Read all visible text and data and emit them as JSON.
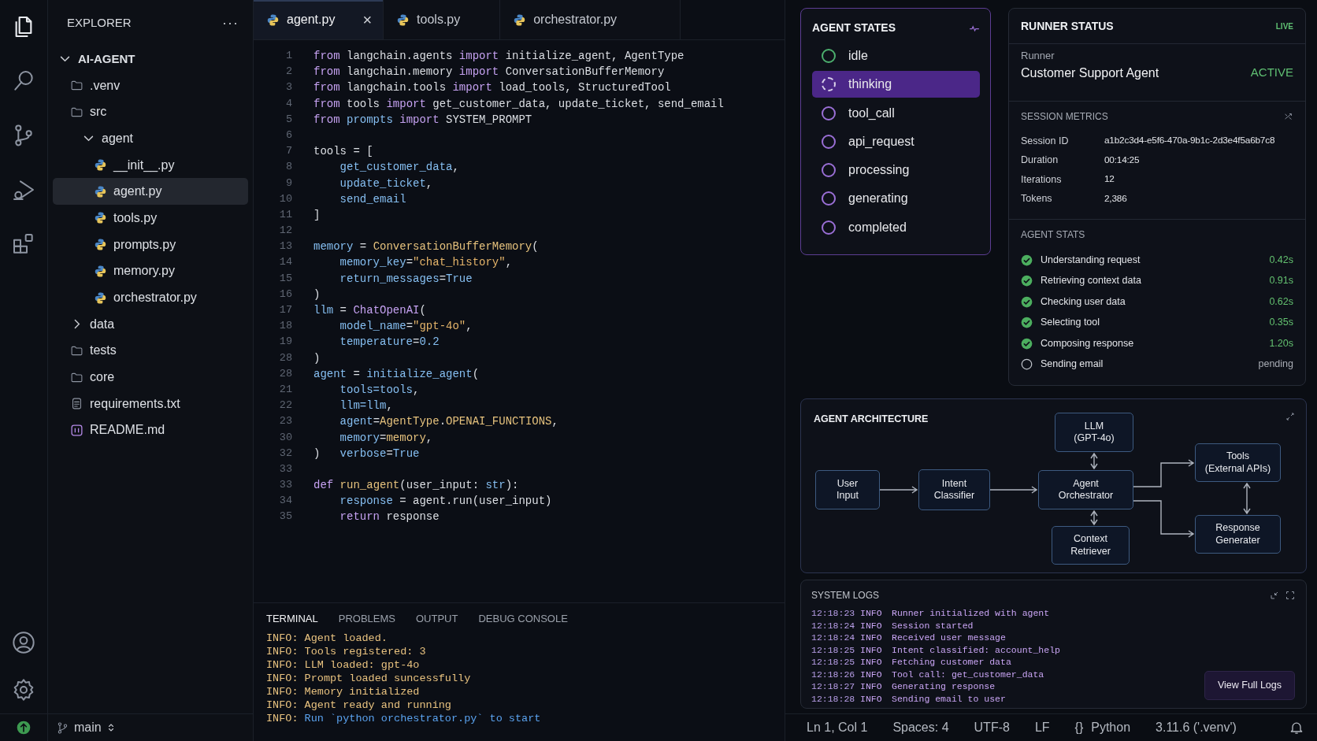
{
  "activity_bar": [
    {
      "selected": true
    },
    {
      "selected": false
    },
    {
      "selected": false
    },
    {
      "selected": false
    },
    {
      "selected": false
    }
  ],
  "sidebar": {
    "title": "EXPLORER",
    "more": "···",
    "tree": [
      {
        "label": "AI-AGENT",
        "kind": "root",
        "expanded": true,
        "selected": false,
        "children": [
          {
            "label": ".venv",
            "kind": "folder",
            "selected": false
          },
          {
            "label": "src",
            "kind": "folder",
            "selected": false,
            "children": [
              {
                "label": "agent",
                "expanded": true,
                "selected": false,
                "children": [
                  {
                    "label": "__init__.py",
                    "kind": "python",
                    "selected": false
                  },
                  {
                    "label": "agent.py",
                    "kind": "python",
                    "selected": true
                  },
                  {
                    "label": "tools.py",
                    "kind": "python",
                    "selected": false
                  },
                  {
                    "label": "prompts.py",
                    "kind": "python",
                    "selected": false
                  },
                  {
                    "label": "memory.py",
                    "kind": "python",
                    "selected": false
                  },
                  {
                    "label": "orchestrator.py",
                    "kind": "python",
                    "selected": false
                  }
                ]
              }
            ]
          },
          {
            "label": "data",
            "expanded": false,
            "selected": false
          },
          {
            "label": "tests",
            "kind": "folder",
            "selected": false
          },
          {
            "label": "core",
            "kind": "folder",
            "selected": false
          },
          {
            "label": "requirements.txt",
            "kind": "text",
            "selected": false
          },
          {
            "label": "README.md",
            "kind": "markdown",
            "selected": false
          }
        ]
      }
    ]
  },
  "branch": "main",
  "editor_tabs": [
    {
      "label": "agent.py",
      "selected": true,
      "close": "×"
    },
    {
      "label": "tools.py",
      "selected": false
    },
    {
      "label": "orchestrator.py",
      "selected": false
    }
  ],
  "code": [
    {
      "number": "1",
      "tokens": [
        {
          "text": "from",
          "kind": "keyword"
        },
        {
          "text": " langchain.agents ",
          "kind": "plain"
        },
        {
          "text": "import",
          "kind": "keyword"
        },
        {
          "text": " initialize_agent, AgentType",
          "kind": "plain"
        }
      ]
    },
    {
      "number": "2",
      "tokens": [
        {
          "text": "from",
          "kind": "keyword"
        },
        {
          "text": " langchain.memory ",
          "kind": "plain"
        },
        {
          "text": "import",
          "kind": "keyword"
        },
        {
          "text": " ConversationBufferMemory",
          "kind": "plain"
        }
      ]
    },
    {
      "number": "3",
      "tokens": [
        {
          "text": "from",
          "kind": "keyword"
        },
        {
          "text": " langchain.tools ",
          "kind": "plain"
        },
        {
          "text": "import",
          "kind": "keyword"
        },
        {
          "text": " load_tools, StructuredTool",
          "kind": "plain"
        }
      ]
    },
    {
      "number": "4",
      "tokens": [
        {
          "text": "from",
          "kind": "keyword"
        },
        {
          "text": " tools ",
          "kind": "plain"
        },
        {
          "text": "import",
          "kind": "keyword"
        },
        {
          "text": " get_customer_data, update_ticket, send_email",
          "kind": "plain"
        }
      ]
    },
    {
      "number": "5",
      "tokens": [
        {
          "text": "from",
          "kind": "keyword"
        },
        {
          "text": " prompts ",
          "kind": "name"
        },
        {
          "text": "import",
          "kind": "keyword"
        },
        {
          "text": " SYSTEM_PROMPT",
          "kind": "plain"
        }
      ]
    },
    {
      "number": "6"
    },
    {
      "number": "7",
      "tokens": [
        {
          "text": "tools = [",
          "kind": "plain"
        }
      ]
    },
    {
      "number": "8",
      "tokens": [
        {
          "text": "    get_customer_data",
          "kind": "name"
        },
        {
          "text": ",",
          "kind": "plain"
        }
      ]
    },
    {
      "number": "9",
      "tokens": [
        {
          "text": "    update_ticket",
          "kind": "name"
        },
        {
          "text": ",",
          "kind": "plain"
        }
      ]
    },
    {
      "number": "10",
      "tokens": [
        {
          "text": "    send_email",
          "kind": "name"
        }
      ]
    },
    {
      "number": "11",
      "tokens": [
        {
          "text": "]",
          "kind": "plain"
        }
      ]
    },
    {
      "number": "12"
    },
    {
      "number": "13",
      "tokens": [
        {
          "text": "memory",
          "kind": "name"
        },
        {
          "text": " = ",
          "kind": "plain"
        },
        {
          "text": "ConversationBufferMemory",
          "kind": "class"
        },
        {
          "text": "(",
          "kind": "plain"
        }
      ]
    },
    {
      "number": "14",
      "tokens": [
        {
          "text": "    memory_key",
          "kind": "name"
        },
        {
          "text": "=",
          "kind": "plain"
        },
        {
          "text": "\"chat_history\"",
          "kind": "string"
        },
        {
          "text": ",",
          "kind": "plain"
        }
      ]
    },
    {
      "number": "15",
      "tokens": [
        {
          "text": "    return_messages",
          "kind": "name"
        },
        {
          "text": "=",
          "kind": "plain"
        },
        {
          "text": "True",
          "kind": "name"
        }
      ]
    },
    {
      "number": "16",
      "tokens": [
        {
          "text": ")",
          "kind": "plain"
        }
      ]
    },
    {
      "number": "17",
      "tokens": [
        {
          "text": "llm",
          "kind": "name"
        },
        {
          "text": " = ",
          "kind": "plain"
        },
        {
          "text": "ChatOpenAI",
          "kind": "keyword"
        },
        {
          "text": "(",
          "kind": "plain"
        }
      ]
    },
    {
      "number": "18",
      "tokens": [
        {
          "text": "    model_name",
          "kind": "name"
        },
        {
          "text": "=",
          "kind": "plain"
        },
        {
          "text": "\"gpt-4o\"",
          "kind": "string"
        },
        {
          "text": ",",
          "kind": "plain"
        }
      ]
    },
    {
      "number": "19",
      "tokens": [
        {
          "text": "    temperature",
          "kind": "name"
        },
        {
          "text": "=",
          "kind": "plain"
        },
        {
          "text": "0.2",
          "kind": "name"
        }
      ]
    },
    {
      "number": "28",
      "tokens": [
        {
          "text": ")",
          "kind": "plain"
        }
      ]
    },
    {
      "number": "28",
      "tokens": [
        {
          "text": "agent",
          "kind": "name"
        },
        {
          "text": " = ",
          "kind": "plain"
        },
        {
          "text": "initialize_agent",
          "kind": "name"
        },
        {
          "text": "(",
          "kind": "plain"
        }
      ]
    },
    {
      "number": "21",
      "tokens": [
        {
          "text": "    tools=tools",
          "kind": "name"
        },
        {
          "text": ",",
          "kind": "plain"
        }
      ]
    },
    {
      "number": "22",
      "tokens": [
        {
          "text": "    llm=llm",
          "kind": "name"
        },
        {
          "text": ",",
          "kind": "plain"
        }
      ]
    },
    {
      "number": "23",
      "tokens": [
        {
          "text": "    agent",
          "kind": "name"
        },
        {
          "text": "=",
          "kind": "plain"
        },
        {
          "text": "AgentType",
          "kind": "class"
        },
        {
          "text": ".",
          "kind": "plain"
        },
        {
          "text": "OPENAI_FUNCTIONS",
          "kind": "class"
        },
        {
          "text": ",",
          "kind": "plain"
        }
      ]
    },
    {
      "number": "30",
      "tokens": [
        {
          "text": "    memory",
          "kind": "name"
        },
        {
          "text": "=",
          "kind": "plain"
        },
        {
          "text": "memory",
          "kind": "class"
        },
        {
          "text": ",",
          "kind": "plain"
        }
      ]
    },
    {
      "number": "32",
      "tokens": [
        {
          "text": ")",
          "kind": "plain"
        },
        {
          "text": "   verbose",
          "kind": "name"
        },
        {
          "text": "=",
          "kind": "plain"
        },
        {
          "text": "True",
          "kind": "name"
        }
      ]
    },
    {
      "number": "33"
    },
    {
      "number": "33",
      "tokens": [
        {
          "text": "def",
          "kind": "keyword"
        },
        {
          "text": " run_agent",
          "kind": "class"
        },
        {
          "text": "(user_input: ",
          "kind": "plain"
        },
        {
          "text": "str",
          "kind": "name"
        },
        {
          "text": "):",
          "kind": "plain"
        }
      ]
    },
    {
      "number": "34",
      "tokens": [
        {
          "text": "    response",
          "kind": "name"
        },
        {
          "text": " = agent.run(user_input)",
          "kind": "plain"
        }
      ]
    },
    {
      "number": "35",
      "tokens": [
        {
          "text": "    return",
          "kind": "keyword"
        },
        {
          "text": " response",
          "kind": "plain"
        }
      ]
    }
  ],
  "terminal": {
    "tabs": [
      {
        "label": "TERMINAL",
        "selected": true
      },
      {
        "label": "PROBLEMS",
        "selected": false
      },
      {
        "label": "OUTPUT",
        "selected": false
      },
      {
        "label": "DEBUG CONSOLE",
        "selected": false
      }
    ],
    "lines": [
      {
        "prefix": "INFO:",
        "text": "Agent loaded.",
        "kind": "log"
      },
      {
        "prefix": "INFO:",
        "text": "Tools registered: 3",
        "kind": "log"
      },
      {
        "prefix": "INFO:",
        "text": "LLM loaded: gpt-4o",
        "kind": "log"
      },
      {
        "prefix": "INFO:",
        "text": "Prompt loaded suncessfully",
        "kind": "log"
      },
      {
        "prefix": "INFO:",
        "text": "Memory initialized",
        "kind": "log"
      },
      {
        "prefix": "INFO:",
        "text": "Agent ready and running",
        "kind": "log"
      },
      {
        "prefix": "INFO:",
        "text": "Run `python orchestrator.py` to start",
        "kind": "command"
      }
    ]
  },
  "agent_states": {
    "title": "AGENT STATES",
    "states": [
      {
        "label": "idle",
        "selected": false,
        "color": "#4caf6e"
      },
      {
        "label": "thinking",
        "selected": true,
        "color": "#d9d2ea"
      },
      {
        "label": "tool_call",
        "selected": false,
        "color": "#9a6fd6"
      },
      {
        "label": "api_request",
        "selected": false,
        "color": "#9a6fd6"
      },
      {
        "label": "processing",
        "selected": false,
        "color": "#9a6fd6"
      },
      {
        "label": "generating",
        "selected": false,
        "color": "#9a6fd6"
      },
      {
        "label": "completed",
        "selected": false,
        "color": "#9a6fd6"
      }
    ]
  },
  "runner_status": {
    "title": "RUNNER STATUS",
    "badge": "LIVE",
    "runner_label": "Runner",
    "runner_name": "Customer Support Agent",
    "runner_state": "ACTIVE"
  },
  "session_metrics": {
    "title": "SESSION METRICS",
    "rows": [
      {
        "label": "Session ID",
        "value": "a1b2c3d4-e5f6-470a-9b1c-2d3e4f5a6b7c8"
      },
      {
        "label": "Duration",
        "value": "00:14:25"
      },
      {
        "label": "Iterations",
        "value": "12"
      },
      {
        "label": "Tokens",
        "value": "2,386"
      }
    ]
  },
  "agent_stats": {
    "title": "AGENT STATS",
    "steps": [
      {
        "label": "Understanding request",
        "time": "0.42s",
        "done": true
      },
      {
        "label": "Retrieving context data",
        "time": "0.91s",
        "done": true
      },
      {
        "label": "Checking user data",
        "time": "0.62s",
        "done": true
      },
      {
        "label": "Selecting tool",
        "time": "0.35s",
        "done": true
      },
      {
        "label": "Composing response",
        "time": "1.20s",
        "done": true
      },
      {
        "label": "Sending email",
        "time": "pending",
        "done": false
      }
    ]
  },
  "architecture": {
    "title": "AGENT ARCHITECTURE",
    "nodes": [
      {
        "lines": [
          "LLM",
          "(GPT-4o)"
        ]
      },
      {
        "lines": [
          "Tools",
          "(External APIs)"
        ]
      },
      {
        "lines": [
          "User",
          "Input"
        ]
      },
      {
        "lines": [
          "Intent",
          "Classifier"
        ]
      },
      {
        "lines": [
          "Agent",
          "Orchestrator"
        ]
      },
      {
        "lines": [
          "Response",
          "Generater"
        ]
      },
      {
        "lines": [
          "Context",
          "Retriever"
        ]
      }
    ]
  },
  "system_logs": {
    "title": "SYSTEM LOGS",
    "entries": [
      {
        "time": "12:18:23",
        "level": "INFO",
        "message": "Runner initialized with agent"
      },
      {
        "time": "12:18:24",
        "level": "INFO",
        "message": "Session started"
      },
      {
        "time": "12:18:24",
        "level": "INFO",
        "message": "Received user message"
      },
      {
        "time": "12:18:25",
        "level": "INFO",
        "message": "Intent classified: account_help"
      },
      {
        "time": "12:18:25",
        "level": "INFO",
        "message": "Fetching customer data"
      },
      {
        "time": "12:18:26",
        "level": "INFO",
        "message": "Tool call: get_customer_data"
      },
      {
        "time": "12:18:27",
        "level": "INFO",
        "message": "Generating response"
      },
      {
        "time": "12:18:28",
        "level": "INFO",
        "message": "Sending email to user"
      }
    ],
    "button": "View Full Logs"
  },
  "status_bar": [
    "Ln 1, Col 1",
    "Spaces: 4",
    "UTF-8",
    "LF",
    "{}",
    "Python",
    "3.11.6 ('.venv')"
  ]
}
